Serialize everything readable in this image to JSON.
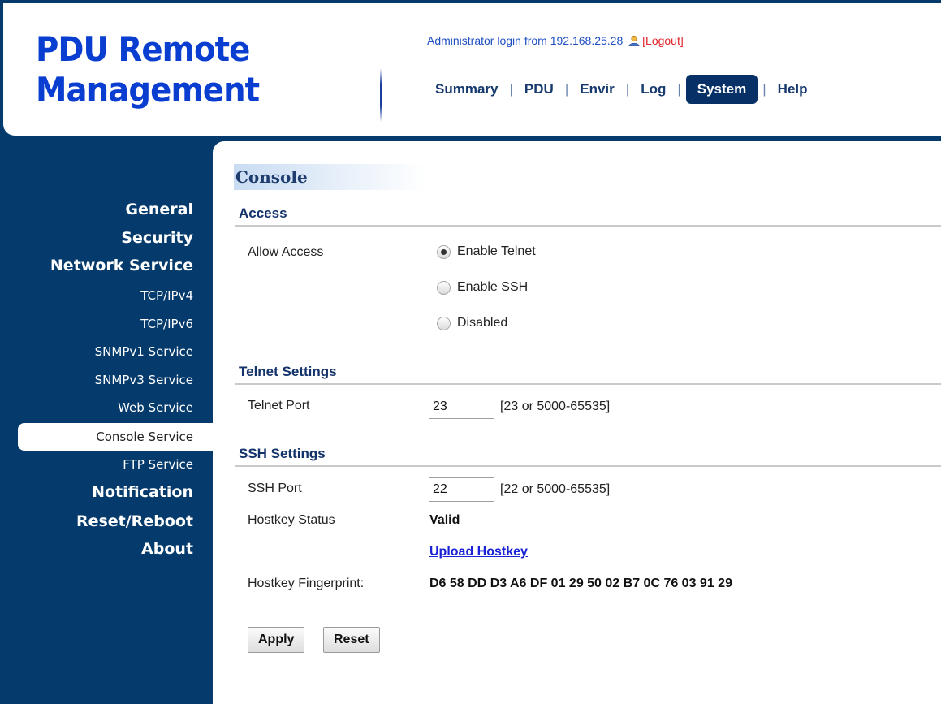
{
  "header": {
    "logo_line1": "PDU Remote",
    "logo_line2": "Management",
    "login_text": "Administrator login from 192.168.25.28",
    "logout_label": "[Logout]",
    "nav": {
      "summary": "Summary",
      "pdu": "PDU",
      "envir": "Envir",
      "log": "Log",
      "system": "System",
      "help": "Help",
      "separator": "|"
    }
  },
  "sidebar": {
    "general": "General",
    "security": "Security",
    "network_service": "Network Service",
    "tcp_ipv4": "TCP/IPv4",
    "tcp_ipv6": "TCP/IPv6",
    "snmpv1": "SNMPv1 Service",
    "snmpv3": "SNMPv3 Service",
    "web": "Web Service",
    "console": "Console Service",
    "ftp": "FTP Service",
    "notification": "Notification",
    "reset_reboot": "Reset/Reboot",
    "about": "About",
    "selected": "Console Service"
  },
  "main": {
    "title": "Console",
    "access": {
      "heading": "Access",
      "allow_label": "Allow Access",
      "options": [
        "Enable Telnet",
        "Enable SSH",
        "Disabled"
      ],
      "selected": "Enable Telnet"
    },
    "telnet": {
      "heading": "Telnet Settings",
      "port_label": "Telnet Port",
      "port_value": "23",
      "port_hint": "[23 or 5000-65535]"
    },
    "ssh": {
      "heading": "SSH Settings",
      "port_label": "SSH Port",
      "port_value": "22",
      "port_hint": "[22 or 5000-65535]",
      "hostkey_status_label": "Hostkey Status",
      "hostkey_status_value": "Valid",
      "upload_label": "Upload Hostkey",
      "fingerprint_label": "Hostkey Fingerprint:",
      "fingerprint_value": "D6 58 DD D3 A6 DF 01 29 50 02 B7 0C 76 03 91 29"
    },
    "buttons": {
      "apply": "Apply",
      "reset": "Reset"
    }
  },
  "colors": {
    "navy": "#053a6c",
    "logo_blue": "#0a3ed1",
    "logout_red": "#e0242b",
    "link_blue": "#1a24d6"
  }
}
